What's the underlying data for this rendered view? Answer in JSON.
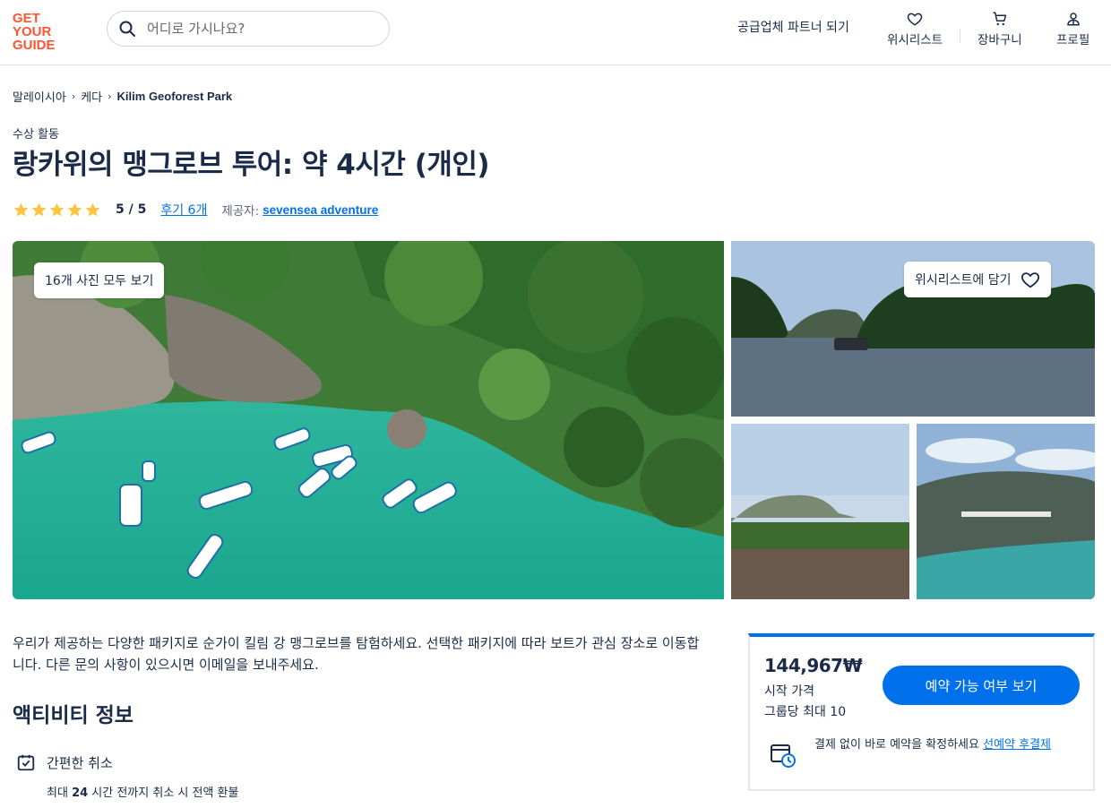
{
  "header": {
    "logo": {
      "line1": "GET",
      "line2": "YOUR",
      "line3": "GUIDE"
    },
    "search_placeholder": "어디로 가시나요?",
    "supplier_link": "공급업체 파트너 되기",
    "nav": {
      "wishlist": "위시리스트",
      "cart": "장바구니",
      "profile": "프로필"
    }
  },
  "breadcrumb": [
    "말레이시아",
    "케다",
    "Kilim Geoforest Park"
  ],
  "category": "수상 활동",
  "title": "랑카위의 맹그로브 투어: 약 4시간 (개인)",
  "rating": {
    "stars": 5,
    "score": "5 / 5",
    "reviews": "후기 6개",
    "provider_label": "제공자:",
    "provider": "sevensea adventure"
  },
  "gallery": {
    "view_all": "16개 사진 모두 보기",
    "wishlist_add": "위시리스트에 담기"
  },
  "description": "우리가 제공하는 다양한 패키지로 순가이 킬림 강 맹그로브를 탐험하세요. 선택한 패키지에 따라 보트가 관심 장소로 이동합니다. 다른 문의 사항이 있으시면 이메일을 보내주세요.",
  "activity_info": {
    "title": "액티비티 정보",
    "feature_title": "간편한 취소",
    "feature_desc_prefix": "최대",
    "feature_desc_bold": "24",
    "feature_desc_suffix": "시간 전까지 취소 시 전액 환불"
  },
  "booking": {
    "price": "144,967₩",
    "price_label": "시작 가격",
    "group_label": "그룹당 최대 10",
    "button": "예약 가능 여부 보기",
    "reserve_text": "결제 없이 바로 예약을 확정하세요",
    "reserve_link": "선예약 후결제"
  },
  "colors": {
    "brand": "#ff5533",
    "accent": "#0071eb",
    "text": "#1a2b49",
    "star": "#fdc53f"
  }
}
